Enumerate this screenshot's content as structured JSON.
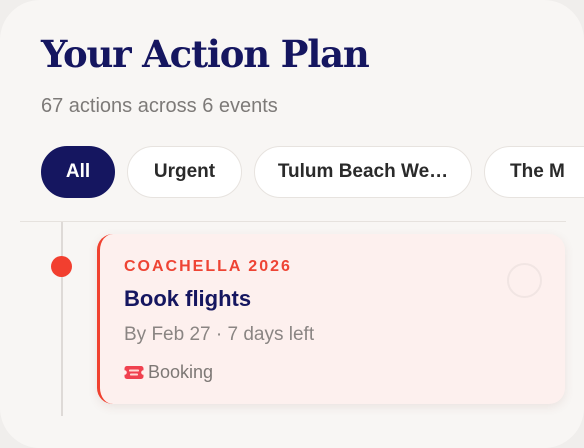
{
  "header": {
    "title": "Your Action Plan",
    "subtitle": "67 actions across 6 events"
  },
  "filters": {
    "items": [
      {
        "label": "All",
        "active": true
      },
      {
        "label": "Urgent",
        "active": false
      },
      {
        "label": "Tulum Beach We…",
        "active": false
      },
      {
        "label": "The M",
        "active": false
      }
    ]
  },
  "timeline": {
    "dot_color": "#f23f2f"
  },
  "actions": [
    {
      "event": "COACHELLA 2026",
      "title": "Book flights",
      "due": "By Feb 27 · 7 days left",
      "category": "Booking",
      "category_icon": "ticket-icon",
      "accent_color": "#f0412f",
      "completed": false
    }
  ],
  "colors": {
    "brand_navy": "#151660",
    "urgent_red": "#f0412f",
    "card_background": "#fdf0ee",
    "page_background": "#f8f6f4"
  }
}
